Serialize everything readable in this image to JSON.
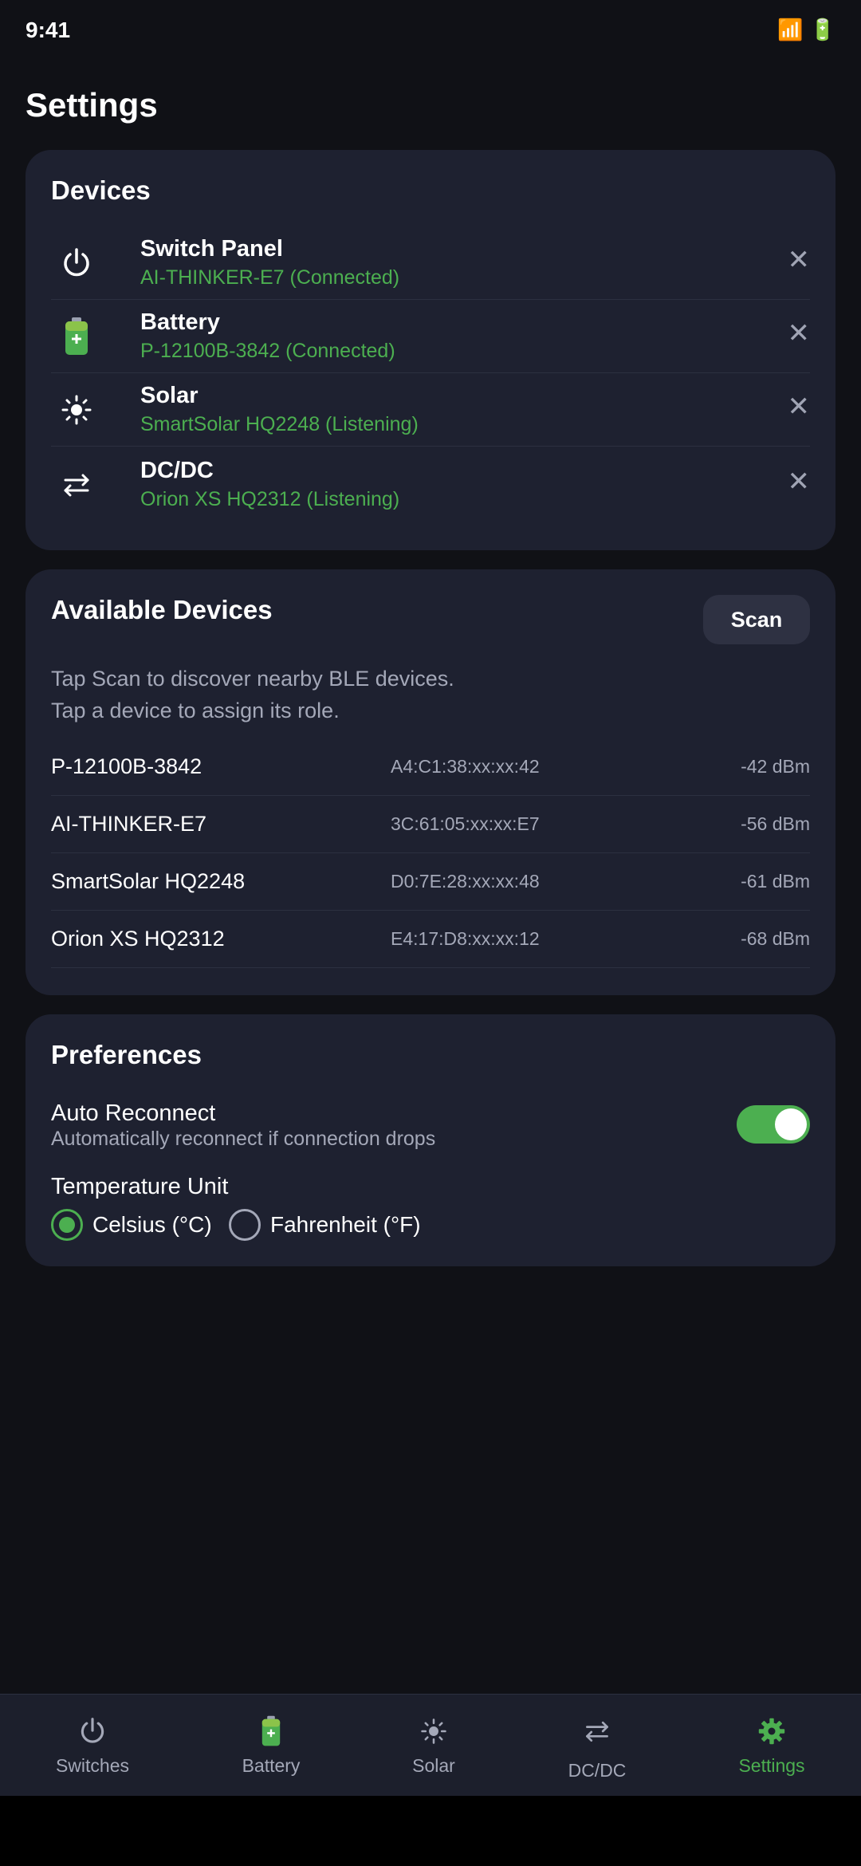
{
  "status": {
    "time": "9:41",
    "signal_icon": "📶",
    "battery_icon": "🔋"
  },
  "page": {
    "title": "Settings"
  },
  "devices": {
    "title": "Devices",
    "items": [
      {
        "name": "Switch Panel",
        "sub": "AI-THINKER-E7 (Connected)",
        "icon": "power-icon",
        "remove": "✕"
      },
      {
        "name": "Battery",
        "sub": "P-12100B-3842 (Connected)",
        "icon": "battery-icon",
        "remove": "✕"
      },
      {
        "name": "Solar",
        "sub": "SmartSolar HQ2248 (Listening)",
        "icon": "sun-icon",
        "remove": "✕"
      },
      {
        "name": "DC/DC",
        "sub": "Orion XS HQ2312 (Listening)",
        "icon": "swap-icon",
        "remove": "✕"
      }
    ]
  },
  "available": {
    "title": "Available Devices",
    "scan_label": "Scan",
    "hint_line1": "Tap Scan to discover nearby BLE devices.",
    "hint_line2": "Tap a device to assign its role.",
    "items": [
      {
        "name": "P-12100B-3842",
        "mac": "A4:C1:38:xx:xx:42",
        "rssi": "-42 dBm"
      },
      {
        "name": "AI-THINKER-E7",
        "mac": "3C:61:05:xx:xx:E7",
        "rssi": "-56 dBm"
      },
      {
        "name": "SmartSolar HQ2248",
        "mac": "D0:7E:28:xx:xx:48",
        "rssi": "-61 dBm"
      },
      {
        "name": "Orion XS HQ2312",
        "mac": "E4:17:D8:xx:xx:12",
        "rssi": "-68 dBm"
      }
    ]
  },
  "preferences": {
    "title": "Preferences",
    "auto_reconnect_label": "Auto Reconnect",
    "auto_reconnect_desc": "Automatically reconnect if connection drops",
    "auto_reconnect_on": true,
    "temp_unit_label": "Temperature Unit",
    "celsius_label": "Celsius (°C)",
    "fahrenheit_label": "Fahrenheit (°F)",
    "selected_unit": "celsius"
  },
  "nav": {
    "items": [
      {
        "label": "Switches",
        "icon": "power-icon"
      },
      {
        "label": "Battery",
        "icon": "battery-icon"
      },
      {
        "label": "Solar",
        "icon": "sun-icon"
      },
      {
        "label": "DC/DC",
        "icon": "swap-icon"
      },
      {
        "label": "Settings",
        "icon": "gear-icon"
      }
    ],
    "active": "Settings"
  },
  "colors": {
    "accent": "#4caf50",
    "card": "#1e2130",
    "background": "#101116"
  }
}
